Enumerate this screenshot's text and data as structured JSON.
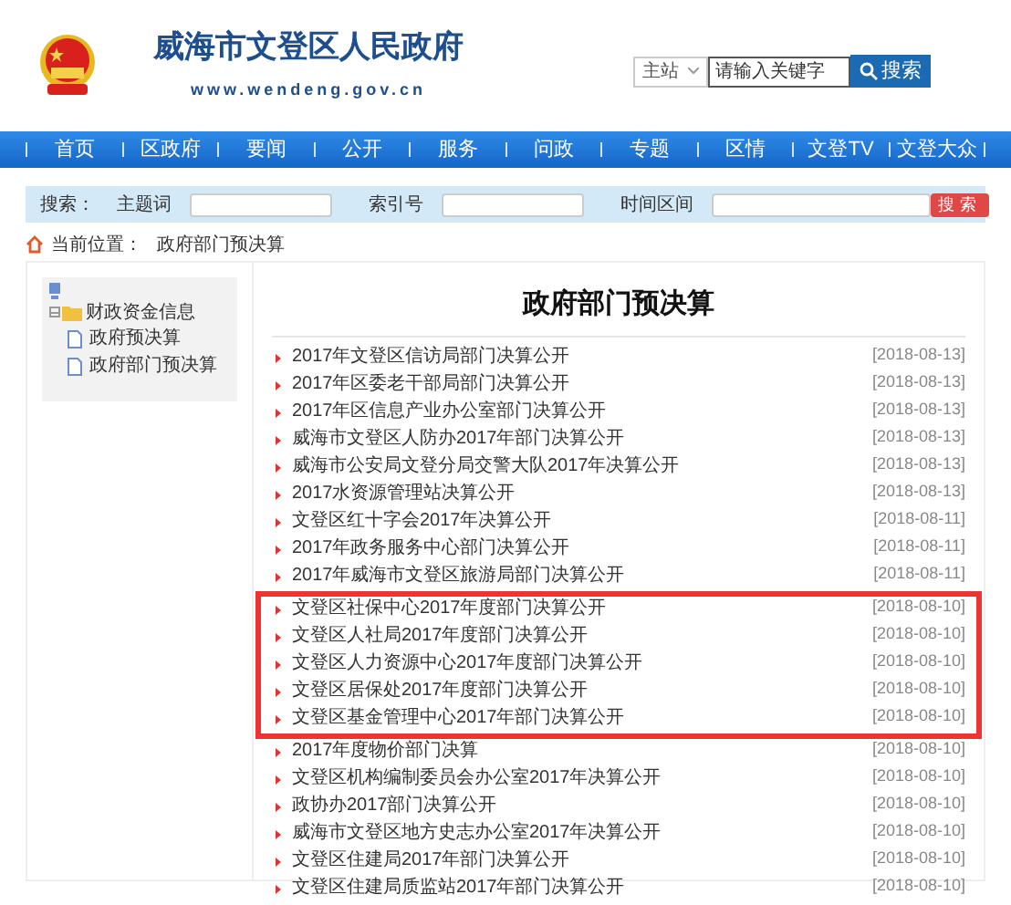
{
  "header": {
    "site_title": "威海市文登区人民政府",
    "url": "www.wendeng.gov.cn",
    "site_select": "主站",
    "search_placeholder": "请输入关键字",
    "search_button": "搜索"
  },
  "nav": [
    "首页",
    "区政府",
    "要闻",
    "公开",
    "服务",
    "问政",
    "专题",
    "区情",
    "文登TV",
    "文登大众"
  ],
  "filter": {
    "label": "搜索：",
    "fields": [
      {
        "label": "主题词"
      },
      {
        "label": "索引号"
      },
      {
        "label": "时间区间"
      }
    ],
    "button": "搜索"
  },
  "breadcrumb": {
    "label": "当前位置：",
    "current": "政府部门预决算"
  },
  "sidebar": {
    "tree": [
      {
        "label": "财政资金信息",
        "expanded": true,
        "children": [
          {
            "label": "政府预决算"
          },
          {
            "label": "政府部门预决算"
          }
        ]
      }
    ]
  },
  "main": {
    "title": "政府部门预决算",
    "rows": [
      {
        "title": "2017年文登区信访局部门决算公开",
        "date": "[2018-08-13]",
        "highlighted": false
      },
      {
        "title": "2017年区委老干部局部门决算公开",
        "date": "[2018-08-13]",
        "highlighted": false
      },
      {
        "title": "2017年区信息产业办公室部门决算公开",
        "date": "[2018-08-13]",
        "highlighted": false
      },
      {
        "title": "威海市文登区人防办2017年部门决算公开",
        "date": "[2018-08-13]",
        "highlighted": false
      },
      {
        "title": "威海市公安局文登分局交警大队2017年决算公开",
        "date": "[2018-08-13]",
        "highlighted": false
      },
      {
        "title": "2017水资源管理站决算公开",
        "date": "[2018-08-13]",
        "highlighted": false
      },
      {
        "title": "文登区红十字会2017年决算公开",
        "date": "[2018-08-11]",
        "highlighted": false
      },
      {
        "title": "2017年政务服务中心部门决算公开",
        "date": "[2018-08-11]",
        "highlighted": false
      },
      {
        "title": "2017年威海市文登区旅游局部门决算公开",
        "date": "[2018-08-11]",
        "highlighted": false
      },
      {
        "title": "文登区社保中心2017年度部门决算公开",
        "date": "[2018-08-10]",
        "highlighted": true
      },
      {
        "title": "文登区人社局2017年度部门决算公开",
        "date": "[2018-08-10]",
        "highlighted": true
      },
      {
        "title": "文登区人力资源中心2017年度部门决算公开",
        "date": "[2018-08-10]",
        "highlighted": true
      },
      {
        "title": "文登区居保处2017年度部门决算公开",
        "date": "[2018-08-10]",
        "highlighted": true
      },
      {
        "title": "文登区基金管理中心2017年部门决算公开",
        "date": "[2018-08-10]",
        "highlighted": true
      },
      {
        "title": "2017年度物价部门决算",
        "date": "[2018-08-10]",
        "highlighted": false
      },
      {
        "title": "文登区机构编制委员会办公室2017年决算公开",
        "date": "[2018-08-10]",
        "highlighted": false
      },
      {
        "title": "政协办2017部门决算公开",
        "date": "[2018-08-10]",
        "highlighted": false
      },
      {
        "title": "威海市文登区地方史志办公室2017年决算公开",
        "date": "[2018-08-10]",
        "highlighted": false
      },
      {
        "title": "文登区住建局2017年部门决算公开",
        "date": "[2018-08-10]",
        "highlighted": false
      },
      {
        "title": "文登区住建局质监站2017年部门决算公开",
        "date": "[2018-08-10]",
        "highlighted": false
      }
    ]
  }
}
